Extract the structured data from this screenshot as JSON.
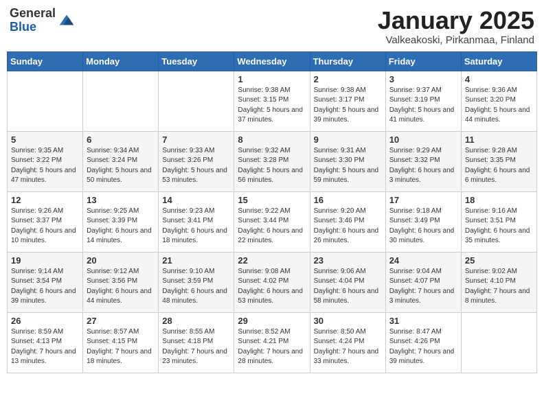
{
  "logo": {
    "general": "General",
    "blue": "Blue"
  },
  "header": {
    "month": "January 2025",
    "location": "Valkeakoski, Pirkanmaa, Finland"
  },
  "weekdays": [
    "Sunday",
    "Monday",
    "Tuesday",
    "Wednesday",
    "Thursday",
    "Friday",
    "Saturday"
  ],
  "weeks": [
    [
      {
        "day": "",
        "info": ""
      },
      {
        "day": "",
        "info": ""
      },
      {
        "day": "",
        "info": ""
      },
      {
        "day": "1",
        "info": "Sunrise: 9:38 AM\nSunset: 3:15 PM\nDaylight: 5 hours and 37 minutes."
      },
      {
        "day": "2",
        "info": "Sunrise: 9:38 AM\nSunset: 3:17 PM\nDaylight: 5 hours and 39 minutes."
      },
      {
        "day": "3",
        "info": "Sunrise: 9:37 AM\nSunset: 3:19 PM\nDaylight: 5 hours and 41 minutes."
      },
      {
        "day": "4",
        "info": "Sunrise: 9:36 AM\nSunset: 3:20 PM\nDaylight: 5 hours and 44 minutes."
      }
    ],
    [
      {
        "day": "5",
        "info": "Sunrise: 9:35 AM\nSunset: 3:22 PM\nDaylight: 5 hours and 47 minutes."
      },
      {
        "day": "6",
        "info": "Sunrise: 9:34 AM\nSunset: 3:24 PM\nDaylight: 5 hours and 50 minutes."
      },
      {
        "day": "7",
        "info": "Sunrise: 9:33 AM\nSunset: 3:26 PM\nDaylight: 5 hours and 53 minutes."
      },
      {
        "day": "8",
        "info": "Sunrise: 9:32 AM\nSunset: 3:28 PM\nDaylight: 5 hours and 56 minutes."
      },
      {
        "day": "9",
        "info": "Sunrise: 9:31 AM\nSunset: 3:30 PM\nDaylight: 5 hours and 59 minutes."
      },
      {
        "day": "10",
        "info": "Sunrise: 9:29 AM\nSunset: 3:32 PM\nDaylight: 6 hours and 3 minutes."
      },
      {
        "day": "11",
        "info": "Sunrise: 9:28 AM\nSunset: 3:35 PM\nDaylight: 6 hours and 6 minutes."
      }
    ],
    [
      {
        "day": "12",
        "info": "Sunrise: 9:26 AM\nSunset: 3:37 PM\nDaylight: 6 hours and 10 minutes."
      },
      {
        "day": "13",
        "info": "Sunrise: 9:25 AM\nSunset: 3:39 PM\nDaylight: 6 hours and 14 minutes."
      },
      {
        "day": "14",
        "info": "Sunrise: 9:23 AM\nSunset: 3:41 PM\nDaylight: 6 hours and 18 minutes."
      },
      {
        "day": "15",
        "info": "Sunrise: 9:22 AM\nSunset: 3:44 PM\nDaylight: 6 hours and 22 minutes."
      },
      {
        "day": "16",
        "info": "Sunrise: 9:20 AM\nSunset: 3:46 PM\nDaylight: 6 hours and 26 minutes."
      },
      {
        "day": "17",
        "info": "Sunrise: 9:18 AM\nSunset: 3:49 PM\nDaylight: 6 hours and 30 minutes."
      },
      {
        "day": "18",
        "info": "Sunrise: 9:16 AM\nSunset: 3:51 PM\nDaylight: 6 hours and 35 minutes."
      }
    ],
    [
      {
        "day": "19",
        "info": "Sunrise: 9:14 AM\nSunset: 3:54 PM\nDaylight: 6 hours and 39 minutes."
      },
      {
        "day": "20",
        "info": "Sunrise: 9:12 AM\nSunset: 3:56 PM\nDaylight: 6 hours and 44 minutes."
      },
      {
        "day": "21",
        "info": "Sunrise: 9:10 AM\nSunset: 3:59 PM\nDaylight: 6 hours and 48 minutes."
      },
      {
        "day": "22",
        "info": "Sunrise: 9:08 AM\nSunset: 4:02 PM\nDaylight: 6 hours and 53 minutes."
      },
      {
        "day": "23",
        "info": "Sunrise: 9:06 AM\nSunset: 4:04 PM\nDaylight: 6 hours and 58 minutes."
      },
      {
        "day": "24",
        "info": "Sunrise: 9:04 AM\nSunset: 4:07 PM\nDaylight: 7 hours and 3 minutes."
      },
      {
        "day": "25",
        "info": "Sunrise: 9:02 AM\nSunset: 4:10 PM\nDaylight: 7 hours and 8 minutes."
      }
    ],
    [
      {
        "day": "26",
        "info": "Sunrise: 8:59 AM\nSunset: 4:13 PM\nDaylight: 7 hours and 13 minutes."
      },
      {
        "day": "27",
        "info": "Sunrise: 8:57 AM\nSunset: 4:15 PM\nDaylight: 7 hours and 18 minutes."
      },
      {
        "day": "28",
        "info": "Sunrise: 8:55 AM\nSunset: 4:18 PM\nDaylight: 7 hours and 23 minutes."
      },
      {
        "day": "29",
        "info": "Sunrise: 8:52 AM\nSunset: 4:21 PM\nDaylight: 7 hours and 28 minutes."
      },
      {
        "day": "30",
        "info": "Sunrise: 8:50 AM\nSunset: 4:24 PM\nDaylight: 7 hours and 33 minutes."
      },
      {
        "day": "31",
        "info": "Sunrise: 8:47 AM\nSunset: 4:26 PM\nDaylight: 7 hours and 39 minutes."
      },
      {
        "day": "",
        "info": ""
      }
    ]
  ]
}
